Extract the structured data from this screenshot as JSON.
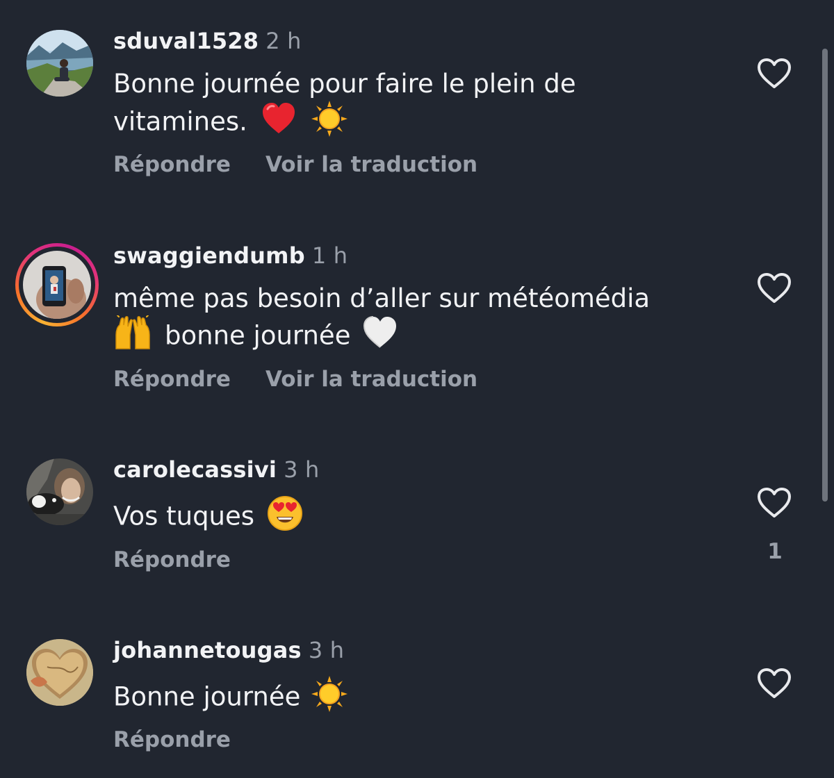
{
  "comments": [
    {
      "username": "sduval1528",
      "time": "2 h",
      "text_line1": "Bonne journée pour faire le plein de",
      "text_line2": "vitamines.",
      "emojis": [
        "red-heart",
        "sun"
      ],
      "reply_label": "Répondre",
      "translate_label": "Voir la traduction"
    },
    {
      "username": "swaggiendumb",
      "time": "1 h",
      "text_line1": "même pas besoin d’aller sur météomédia",
      "text_line2": "bonne journée",
      "emojis": [
        "raising-hands",
        "white-heart"
      ],
      "reply_label": "Répondre",
      "translate_label": "Voir la traduction"
    },
    {
      "username": "carolecassivi",
      "time": "3 h",
      "text_line1": "Vos tuques",
      "emojis": [
        "heart-eyes-face"
      ],
      "reply_label": "Répondre",
      "like_count": "1"
    },
    {
      "username": "johannetougas",
      "time": "3 h",
      "text_line1": "Bonne journée",
      "emojis": [
        "sun"
      ],
      "reply_label": "Répondre"
    }
  ],
  "colors": {
    "background": "#212630",
    "primary_text": "#f2f3f5",
    "secondary_text": "#9aa0aa",
    "story_ring": [
      "#f9b233",
      "#e2337a",
      "#c81e8f"
    ]
  }
}
